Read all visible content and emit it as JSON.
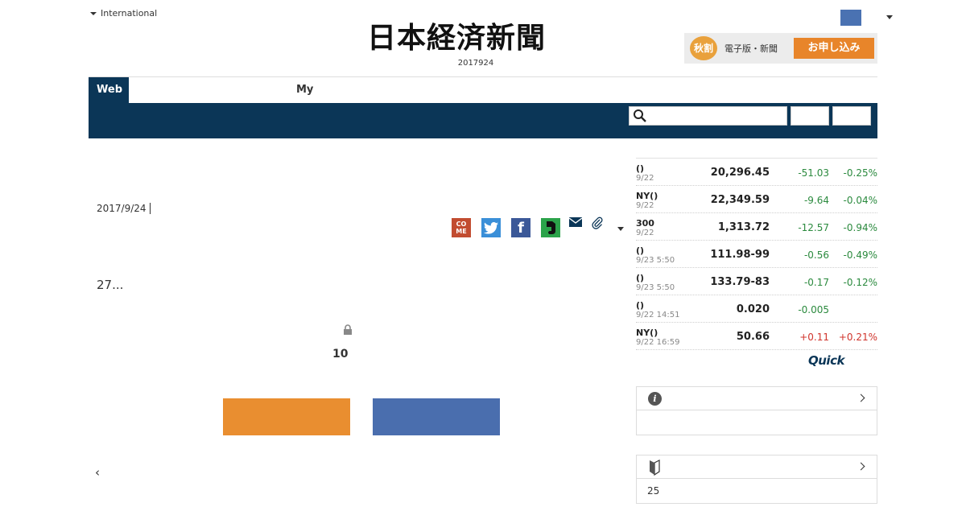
{
  "header": {
    "region_label": "International",
    "logo_text": "日本経済新聞",
    "edition_date": "2017924",
    "promo": {
      "badge": "秋割",
      "subtitle": "電子版・新聞",
      "button_label": "お申し込み"
    }
  },
  "nav": {
    "tab_web": "Web",
    "tab_my": "My",
    "search_placeholder": ""
  },
  "article": {
    "date": "2017/9/24",
    "lead": "27...",
    "remaining_count": "10",
    "back_label": "‹",
    "share_come_label": "CO ME"
  },
  "market": {
    "rows": [
      {
        "name": "()",
        "time": "9/22",
        "value": "20,296.45",
        "change": "-51.03",
        "percent": "-0.25%",
        "dir": "neg"
      },
      {
        "name": "NY()",
        "time": "9/22",
        "value": "22,349.59",
        "change": "-9.64",
        "percent": "-0.04%",
        "dir": "neg"
      },
      {
        "name": "300",
        "time": "9/22",
        "value": "1,313.72",
        "change": "-12.57",
        "percent": "-0.94%",
        "dir": "neg"
      },
      {
        "name": "()",
        "time": "9/23 5:50",
        "value": "111.98-99",
        "change": "-0.56",
        "percent": "-0.49%",
        "dir": "neg"
      },
      {
        "name": "()",
        "time": "9/23 5:50",
        "value": "133.79-83",
        "change": "-0.17",
        "percent": "-0.12%",
        "dir": "neg"
      },
      {
        "name": "()",
        "time": "9/22 14:51",
        "value": "0.020",
        "change": "-0.005",
        "percent": "",
        "dir": "neg"
      },
      {
        "name": "NY()",
        "time": "9/22 16:59",
        "value": "50.66",
        "change": "+0.11",
        "percent": "+0.21%",
        "dir": "pos"
      }
    ],
    "provider": "Quick"
  },
  "side": {
    "info_box_body": "",
    "beginner_box_body": "25"
  },
  "colors": {
    "navy": "#0b3657",
    "orange": "#e98e30",
    "blue": "#4a6eae",
    "negative": "#2b8a3e",
    "positive": "#d0342c"
  }
}
